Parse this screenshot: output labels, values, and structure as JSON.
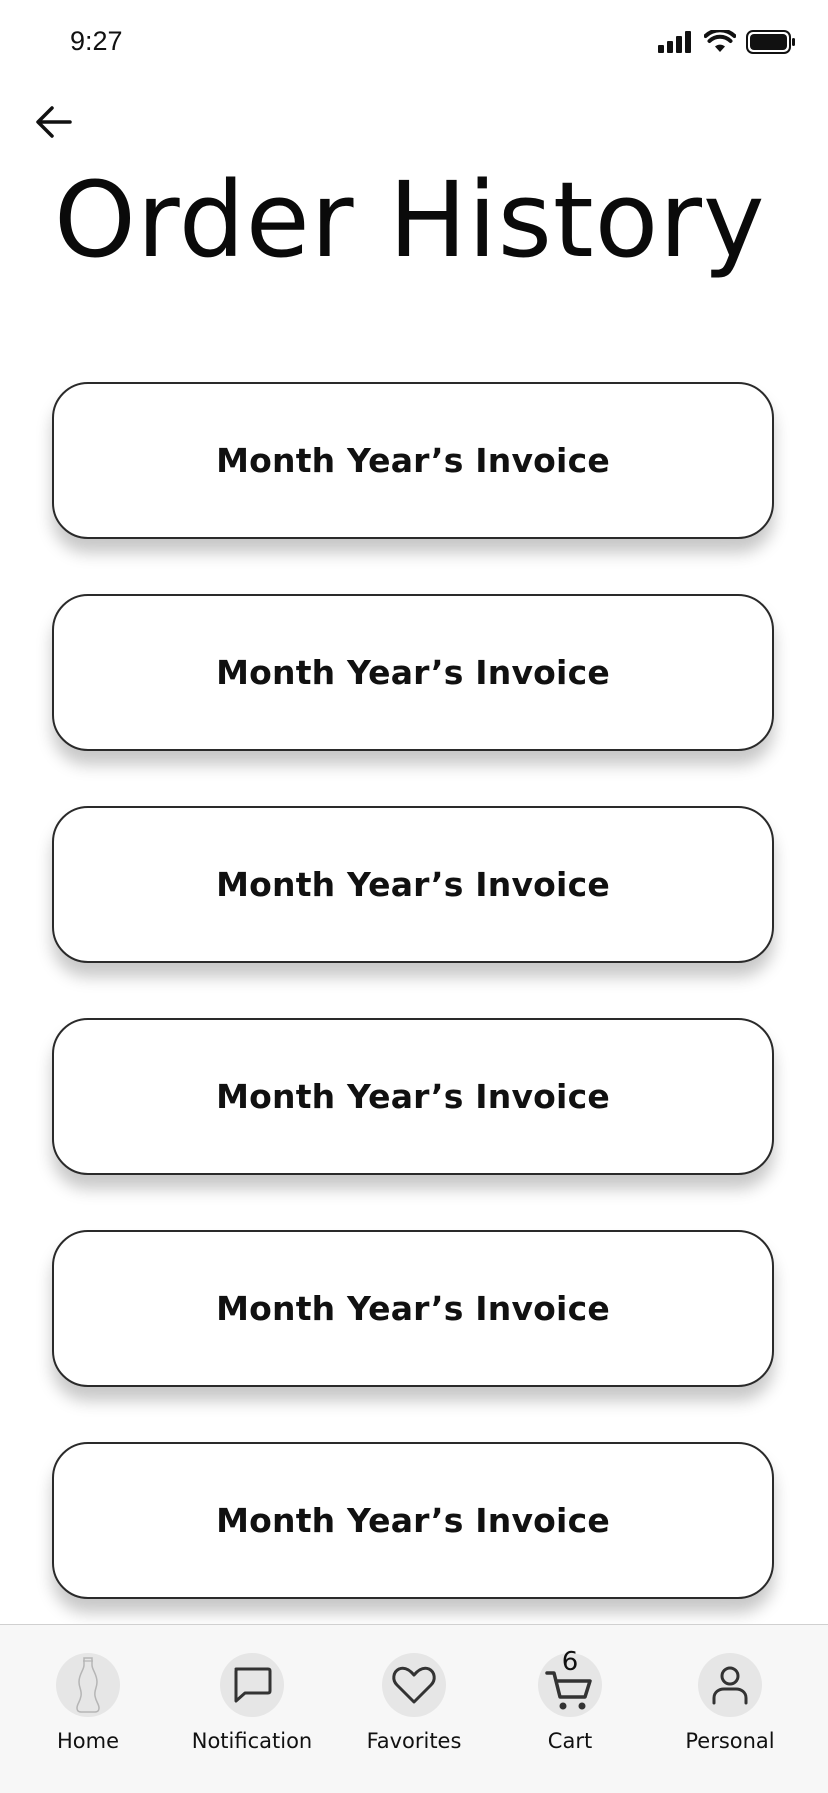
{
  "status_bar": {
    "time": "9:27"
  },
  "header": {
    "back_icon": "arrow-left-icon",
    "title": "Order History"
  },
  "invoices": [
    {
      "label": "Month Year’s Invoice"
    },
    {
      "label": "Month Year’s Invoice"
    },
    {
      "label": "Month Year’s Invoice"
    },
    {
      "label": "Month Year’s Invoice"
    },
    {
      "label": "Month Year’s Invoice"
    },
    {
      "label": "Month Year’s Invoice"
    }
  ],
  "tab_bar": {
    "items": [
      {
        "label": "Home",
        "icon": "bottle-icon"
      },
      {
        "label": "Notification",
        "icon": "chat-bubble-icon"
      },
      {
        "label": "Favorites",
        "icon": "heart-icon"
      },
      {
        "label": "Cart",
        "icon": "cart-icon",
        "badge": "6"
      },
      {
        "label": "Personal",
        "icon": "person-icon"
      }
    ]
  },
  "colors": {
    "background": "#ffffff",
    "card_border": "#2a2a2a",
    "tab_bar_bg": "#f7f7f7",
    "icon_circle": "#e6e6e6"
  }
}
